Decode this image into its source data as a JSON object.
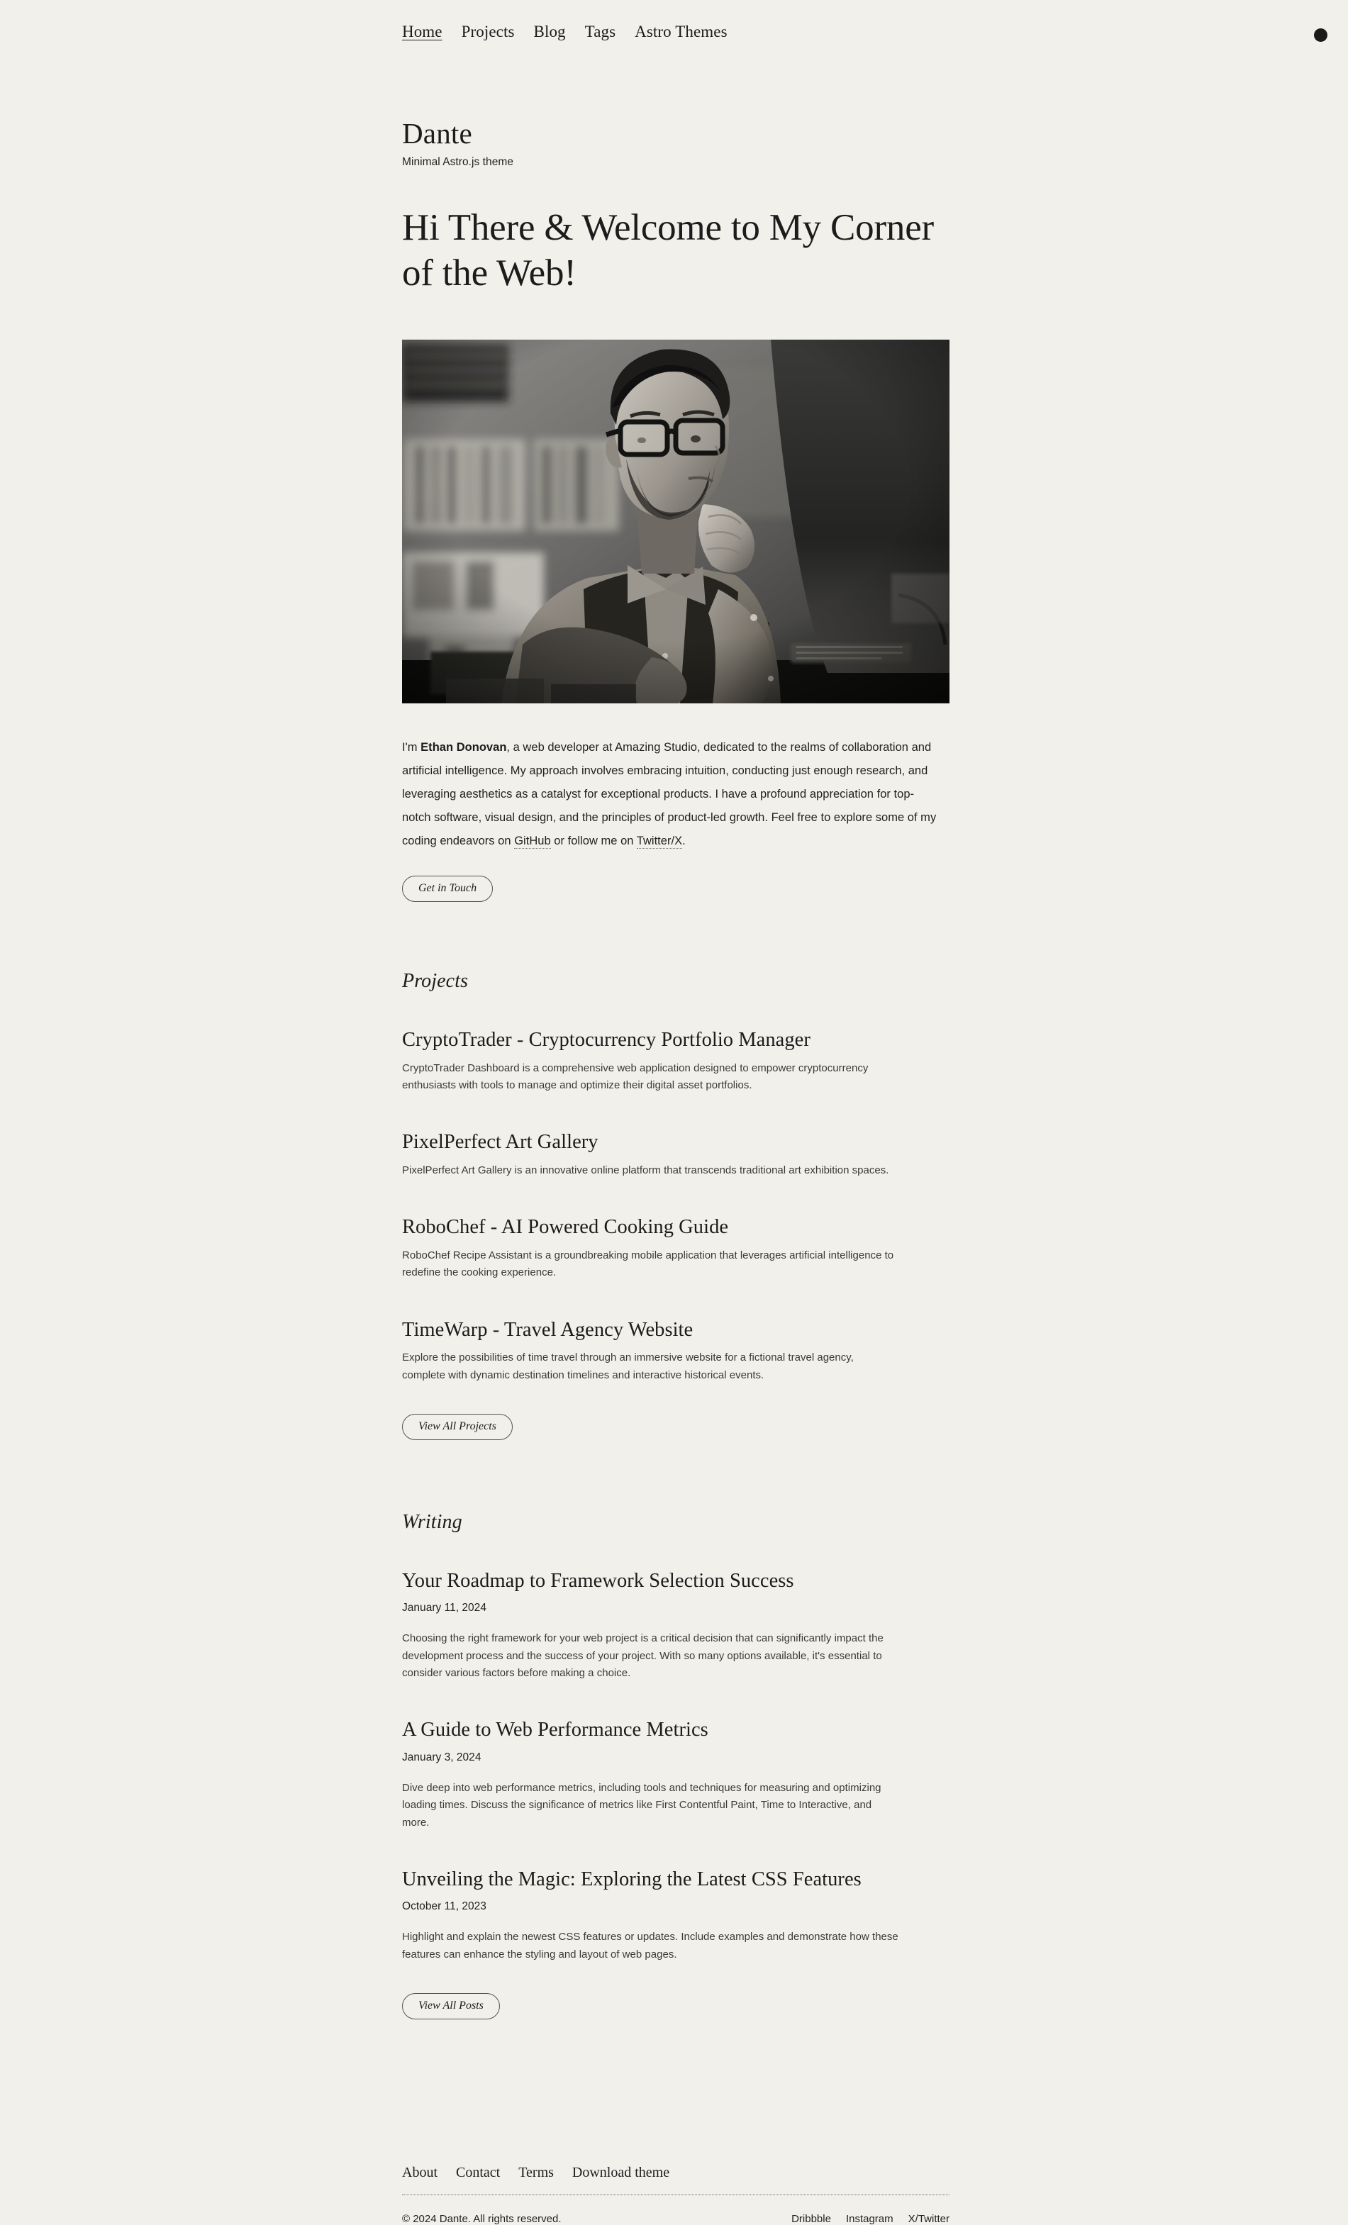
{
  "theme": {
    "background": "#f2f0ea",
    "text": "#1c1c1c",
    "toggle_color": "#1a1a1a"
  },
  "nav": {
    "items": [
      {
        "label": "Home",
        "active": true
      },
      {
        "label": "Projects",
        "active": false
      },
      {
        "label": "Blog",
        "active": false
      },
      {
        "label": "Tags",
        "active": false
      },
      {
        "label": "Astro Themes",
        "active": false
      }
    ],
    "theme_toggle_name": "dark-mode-toggle"
  },
  "header": {
    "title": "Dante",
    "tagline": "Minimal Astro.js theme"
  },
  "hero": {
    "heading": "Hi There & Welcome to My Corner of the Web!",
    "image_alt": "Black and white photo of a bearded man with glasses working at a desktop computer in a dim office",
    "intro": {
      "part1": "I'm ",
      "name": "Ethan Donovan",
      "part2": ", a web developer at Amazing Studio, dedicated to the realms of collaboration and artificial intelligence. My approach involves embracing intuition, conducting just enough research, and leveraging aesthetics as a catalyst for exceptional products. I have a profound appreciation for top-notch software, visual design, and the principles of product-led growth. Feel free to explore some of my coding endeavors on ",
      "link1": "GitHub",
      "part3": " or follow me on ",
      "link2": "Twitter/X",
      "part4": "."
    },
    "cta_label": "Get in Touch"
  },
  "projects": {
    "title": "Projects",
    "items": [
      {
        "title": "CryptoTrader - Cryptocurrency Portfolio Manager",
        "description": "CryptoTrader Dashboard is a comprehensive web application designed to empower cryptocurrency enthusiasts with tools to manage and optimize their digital asset portfolios."
      },
      {
        "title": "PixelPerfect Art Gallery",
        "description": "PixelPerfect Art Gallery is an innovative online platform that transcends traditional art exhibition spaces."
      },
      {
        "title": "RoboChef - AI Powered Cooking Guide",
        "description": "RoboChef Recipe Assistant is a groundbreaking mobile application that leverages artificial intelligence to redefine the cooking experience."
      },
      {
        "title": "TimeWarp - Travel Agency Website",
        "description": "Explore the possibilities of time travel through an immersive website for a fictional travel agency, complete with dynamic destination timelines and interactive historical events."
      }
    ],
    "cta_label": "View All Projects"
  },
  "writing": {
    "title": "Writing",
    "items": [
      {
        "title": "Your Roadmap to Framework Selection Success",
        "date": "January 11, 2024",
        "description": "Choosing the right framework for your web project is a critical decision that can significantly impact the development process and the success of your project. With so many options available, it's essential to consider various factors before making a choice."
      },
      {
        "title": "A Guide to Web Performance Metrics",
        "date": "January 3, 2024",
        "description": "Dive deep into web performance metrics, including tools and techniques for measuring and optimizing loading times. Discuss the significance of metrics like First Contentful Paint, Time to Interactive, and more."
      },
      {
        "title": "Unveiling the Magic: Exploring the Latest CSS Features",
        "date": "October 11, 2023",
        "description": "Highlight and explain the newest CSS features or updates. Include examples and demonstrate how these features can enhance the styling and layout of web pages."
      }
    ],
    "cta_label": "View All Posts"
  },
  "footer": {
    "links": [
      {
        "label": "About"
      },
      {
        "label": "Contact"
      },
      {
        "label": "Terms"
      },
      {
        "label": "Download theme"
      }
    ],
    "copyright": "© 2024 Dante. All rights reserved.",
    "social": [
      {
        "label": "Dribbble"
      },
      {
        "label": "Instagram"
      },
      {
        "label": "X/Twitter"
      }
    ]
  }
}
